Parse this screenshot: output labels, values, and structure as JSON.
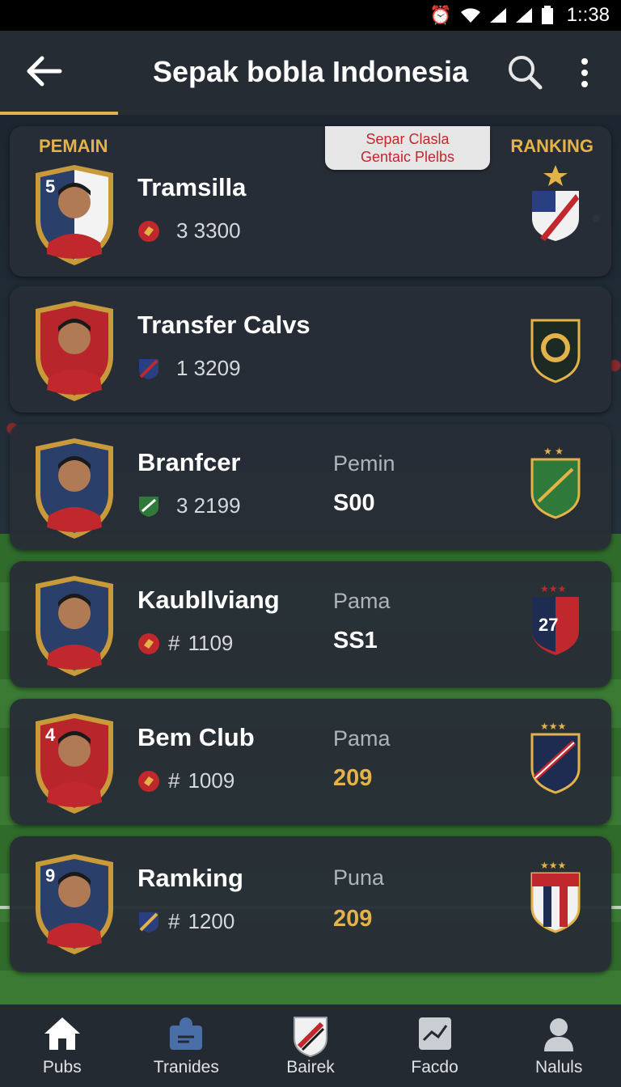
{
  "status_bar": {
    "time": "1::38",
    "icons": [
      "alarm-icon",
      "wifi-icon",
      "signal-icon",
      "signal-icon",
      "battery-icon"
    ]
  },
  "app_bar": {
    "title": "Sepak bobla Indonesia"
  },
  "list_header": {
    "left": "PEMAIN",
    "right": "RANKING"
  },
  "popup": {
    "line1": "Separ Clasla",
    "line2": "Gentaic Plelbs"
  },
  "players": [
    {
      "number": "5",
      "name": "Tramsilla",
      "stat": "3 3300",
      "stat_prefix": "",
      "pos_label": "",
      "pos_value": ""
    },
    {
      "number": "",
      "name": "Transfer Calvs",
      "stat": "1 3209",
      "stat_prefix": "",
      "pos_label": "",
      "pos_value": ""
    },
    {
      "number": "",
      "name": "Branfcer",
      "stat": "3 2199",
      "stat_prefix": "",
      "pos_label": "Pemin",
      "pos_value": "S00"
    },
    {
      "number": "",
      "name": "KaubIlviang",
      "stat": "1109",
      "stat_prefix": "#",
      "pos_label": "Pama",
      "pos_value": "SS1"
    },
    {
      "number": "4",
      "name": "Bem Club",
      "stat": "1009",
      "stat_prefix": "#",
      "pos_label": "Pama",
      "pos_value": "209"
    },
    {
      "number": "9",
      "name": "Ramking",
      "stat": "1200",
      "stat_prefix": "#",
      "pos_label": "Puna",
      "pos_value": "209"
    }
  ],
  "bottom_nav": [
    {
      "label": "Pubs",
      "icon": "home-icon"
    },
    {
      "label": "Tranides",
      "icon": "transfer-icon"
    },
    {
      "label": "Bairek",
      "icon": "shield-icon"
    },
    {
      "label": "Facdo",
      "icon": "chart-icon"
    },
    {
      "label": "Naluls",
      "icon": "profile-icon"
    }
  ],
  "colors": {
    "accent": "#e3b34a",
    "card": "#282e36",
    "appbar": "#262c33"
  }
}
